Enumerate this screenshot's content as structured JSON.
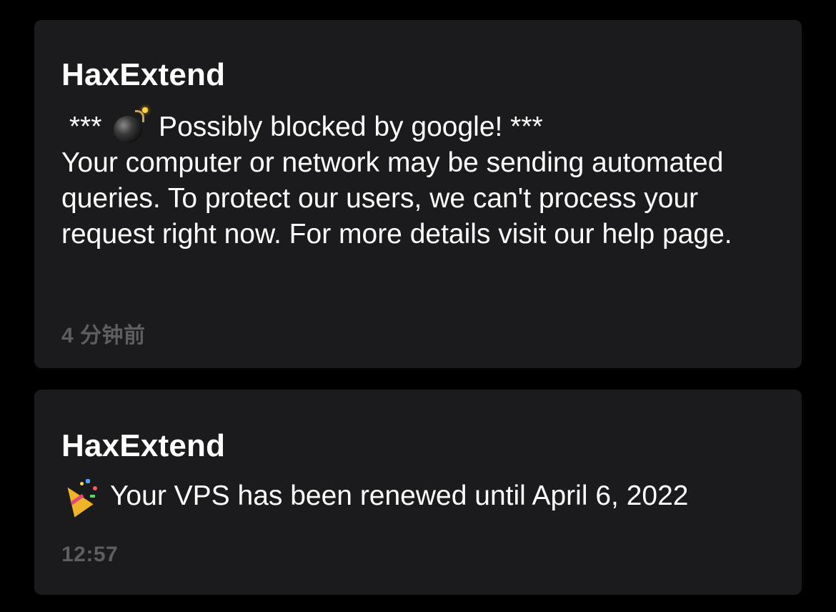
{
  "notifications": [
    {
      "sender": "HaxExtend",
      "line1_prefix": " *** ",
      "line1_icon": "bomb-icon",
      "line1_suffix": " Possibly blocked by google! ***",
      "body": "Your computer or network may be sending automated queries. To protect our users, we can't process your request right now. For more details visit our help page.",
      "time": "4 分钟前"
    },
    {
      "sender": "HaxExtend",
      "icon": "party-popper-icon",
      "body": "Your VPS has been renewed until April 6, 2022",
      "time": "12:57"
    }
  ],
  "colors": {
    "background": "#000000",
    "card": "#1b1b1d",
    "text": "#ffffff",
    "timestamp": "#5e5e62"
  }
}
